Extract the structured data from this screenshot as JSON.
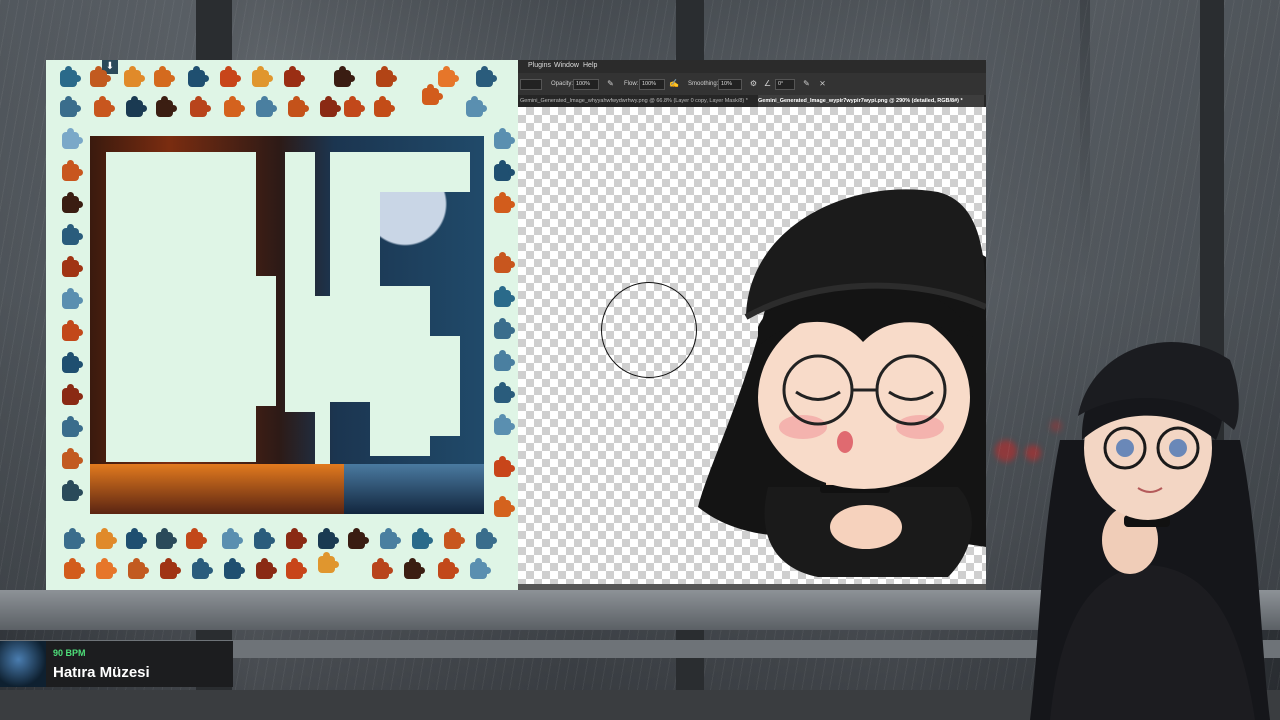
{
  "photoshop": {
    "menu": [
      "Plugins",
      "Window",
      "Help"
    ],
    "options": {
      "opacity_label": "Opacity:",
      "opacity_value": "100%",
      "flow_label": "Flow:",
      "flow_value": "100%",
      "smoothing_label": "Smoothing:",
      "smoothing_value": "10%",
      "angle_value": "0°"
    },
    "tabs": [
      "Gemini_Generated_Image_whyyahwfwydwrhwy.png @ 66.8% (Layer 0 copy, Layer Mask/8) *",
      "Gemini_Generated_Image_wypir7wypir7wypi.png @ 290% (detailed, RGB/8#) *"
    ],
    "active_tab": 1
  },
  "now_playing": {
    "bpm": "90 BPM",
    "title": "Hatıra Müzesi"
  },
  "colors": {
    "puzzle_bg": "#dff5e6",
    "bpm_accent": "#4ee07a"
  },
  "icons": {
    "collapse": "chevrons-down-icon",
    "brush_cursor": "circle-brush-cursor"
  }
}
